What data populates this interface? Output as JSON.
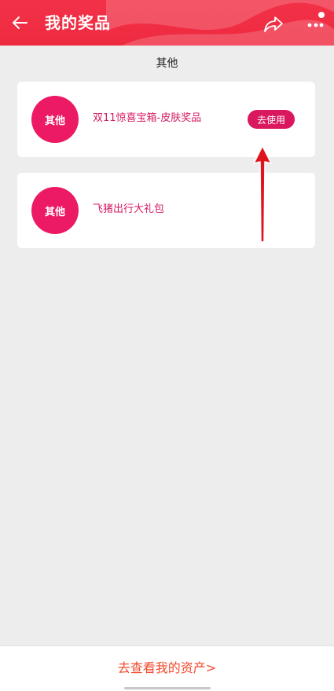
{
  "header": {
    "title": "我的奖品",
    "back_icon": "arrow-left-icon",
    "share_icon": "share-icon",
    "more_icon": "more-icon",
    "background_color": "#f23148"
  },
  "section": {
    "title": "其他"
  },
  "prizes": [
    {
      "badge": "其他",
      "label": "双11惊喜宝箱-皮肤奖品",
      "action_label": "去使用"
    },
    {
      "badge": "其他",
      "label": "飞猪出行大礼包"
    }
  ],
  "footer": {
    "link_label": "去查看我的资产",
    "chevron": ">"
  },
  "colors": {
    "accent": "#ec1a64",
    "label": "#d41b63",
    "footer_link": "#f24a2e"
  }
}
